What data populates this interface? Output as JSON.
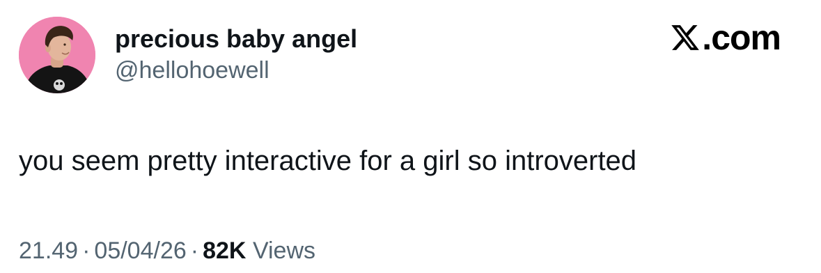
{
  "author": {
    "display_name": "precious baby angel",
    "handle": "@hellohoewell",
    "avatar": "avatar-photo-pink-background"
  },
  "brand": {
    "icon": "x-logo-icon",
    "domain": ".com"
  },
  "tweet": {
    "text": "you seem pretty interactive for a girl so introverted"
  },
  "meta": {
    "time": "21.49",
    "separator": "·",
    "date": "05/04/26",
    "views_count": "82K",
    "views_label": "Views"
  },
  "colors": {
    "text_primary": "#0f1419",
    "text_secondary": "#536471",
    "avatar_bg": "#f084b0"
  }
}
